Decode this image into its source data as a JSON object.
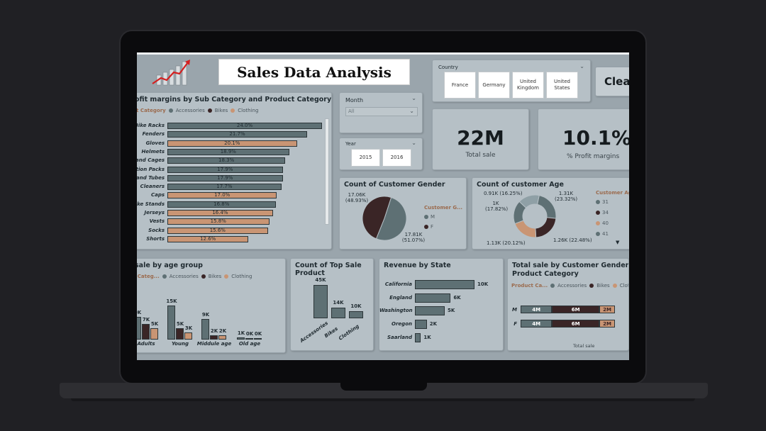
{
  "header": {
    "title": "Sales Data Analysis"
  },
  "country_slicer": {
    "label": "Country",
    "options": [
      "France",
      "Germany",
      "United Kingdom",
      "United States"
    ]
  },
  "clear_button": {
    "label": "Clea"
  },
  "month_slicer": {
    "label": "Month",
    "value": "All"
  },
  "year_slicer": {
    "label": "Year",
    "options": [
      "2015",
      "2016"
    ]
  },
  "kpi": {
    "total_sale": {
      "value": "22M",
      "label": "Total sale"
    },
    "profit_margin": {
      "value": "10.1%",
      "label": "% Profit margins"
    }
  },
  "legend_names": {
    "accessories": "Accessories",
    "bikes": "Bikes",
    "clothing": "Clothing"
  },
  "colors": {
    "accessories": "#5e7074",
    "bikes": "#3a2526",
    "clothing": "#c99574",
    "panel": "#b6c0c6"
  },
  "profit_chart": {
    "title": "ofit margins by Sub Category and Product Category",
    "legend_title": "ct Category",
    "rows": [
      {
        "label": "Bike Racks",
        "value": 24.0,
        "value_label": "24.0%",
        "cat": "accessories"
      },
      {
        "label": "Fenders",
        "value": 21.7,
        "value_label": "21.7%",
        "cat": "accessories"
      },
      {
        "label": "Gloves",
        "value": 20.1,
        "value_label": "20.1%",
        "cat": "clothing"
      },
      {
        "label": "Helmets",
        "value": 18.9,
        "value_label": "18.9%",
        "cat": "accessories"
      },
      {
        "label": "s and Cages",
        "value": 18.3,
        "value_label": "18.3%",
        "cat": "accessories"
      },
      {
        "label": "ation Packs",
        "value": 17.9,
        "value_label": "17.9%",
        "cat": "accessories"
      },
      {
        "label": "s and Tubes",
        "value": 17.9,
        "value_label": "17.9%",
        "cat": "accessories"
      },
      {
        "label": "Cleaners",
        "value": 17.7,
        "value_label": "17.7%",
        "cat": "accessories"
      },
      {
        "label": "Caps",
        "value": 17.0,
        "value_label": "17.0%",
        "cat": "clothing"
      },
      {
        "label": "Bike Stands",
        "value": 16.8,
        "value_label": "16.8%",
        "cat": "accessories"
      },
      {
        "label": "Jerseys",
        "value": 16.4,
        "value_label": "16.4%",
        "cat": "clothing"
      },
      {
        "label": "Vests",
        "value": 15.8,
        "value_label": "15.8%",
        "cat": "clothing"
      },
      {
        "label": "Socks",
        "value": 15.6,
        "value_label": "15.6%",
        "cat": "clothing"
      },
      {
        "label": "Shorts",
        "value": 12.6,
        "value_label": "12.6%",
        "cat": "clothing"
      }
    ]
  },
  "gender_chart": {
    "title": "Count of Customer Gender",
    "legend_title": "Customer G...",
    "legend": [
      "M",
      "F"
    ],
    "slices": [
      {
        "name": "M",
        "value": 17.81,
        "label_value": "17.81K",
        "label_pct": "(51.07%)",
        "color": "#5e7074"
      },
      {
        "name": "F",
        "value": 17.06,
        "label_value": "17.06K",
        "label_pct": "(48.93%)",
        "color": "#3a2526"
      }
    ]
  },
  "age_chart": {
    "title": "Count of customer Age",
    "legend_title": "Customer Ag",
    "legend": [
      {
        "name": "31",
        "color": "#5e7074"
      },
      {
        "name": "34",
        "color": "#3a2526"
      },
      {
        "name": "40",
        "color": "#c99574"
      },
      {
        "name": "41",
        "color": "#5e7074"
      }
    ],
    "slices": [
      {
        "value": 1.31,
        "label": "1.31K\n(23.32%)",
        "color": "#5e7074"
      },
      {
        "value": 1.26,
        "label": "1.26K (22.48%)",
        "color": "#3a2526"
      },
      {
        "value": 1.13,
        "label": "1.13K (20.12%)",
        "color": "#c99574"
      },
      {
        "value": 1.0,
        "label": "1K\n(17.82%)",
        "color": "#5e7074"
      },
      {
        "value": 0.91,
        "label": "0.91K (16.25%)",
        "color": "#8fa0a6"
      }
    ]
  },
  "agegroup_chart": {
    "title": "sale by age group",
    "legend_title": "t Categ...",
    "groups": [
      {
        "name": "Adults",
        "acc": "0K",
        "bik": "7K",
        "clo": "5K",
        "v": [
          10,
          7,
          5
        ]
      },
      {
        "name": "Young",
        "acc": "15K",
        "bik": "5K",
        "clo": "3K",
        "v": [
          15,
          5,
          3
        ]
      },
      {
        "name": "Middule age",
        "acc": "9K",
        "bik": "2K",
        "clo": "2K",
        "v": [
          9,
          2,
          2
        ]
      },
      {
        "name": "Old age",
        "acc": "1K",
        "bik": "0K",
        "clo": "0K",
        "v": [
          1,
          0.2,
          0.2
        ]
      }
    ]
  },
  "top_product_chart": {
    "title": "Count of Top Sale Product",
    "bars": [
      {
        "name": "Accessories",
        "value": 45,
        "label": "45K"
      },
      {
        "name": "Bikes",
        "value": 14,
        "label": "14K"
      },
      {
        "name": "Clothing",
        "value": 10,
        "label": "10K"
      }
    ]
  },
  "revenue_chart": {
    "title": "Revenue by State",
    "rows": [
      {
        "name": "California",
        "value": 10,
        "label": "10K"
      },
      {
        "name": "England",
        "value": 6,
        "label": "6K"
      },
      {
        "name": "Washington",
        "value": 5,
        "label": "5K"
      },
      {
        "name": "Oregon",
        "value": 2,
        "label": "2K"
      },
      {
        "name": "Saarland",
        "value": 1,
        "label": "1K"
      }
    ]
  },
  "gender_stack_chart": {
    "title_line1": "Total sale by Customer Gender and",
    "title_line2": "Product Category",
    "legend_title": "Product Ca...",
    "xlabel": "Total sale",
    "rows": [
      {
        "name": "M",
        "acc": "4M",
        "bik": "6M",
        "clo": "2M",
        "v": [
          4,
          6,
          2
        ]
      },
      {
        "name": "F",
        "acc": "4M",
        "bik": "6M",
        "clo": "2M",
        "v": [
          4,
          6,
          2
        ]
      }
    ]
  }
}
